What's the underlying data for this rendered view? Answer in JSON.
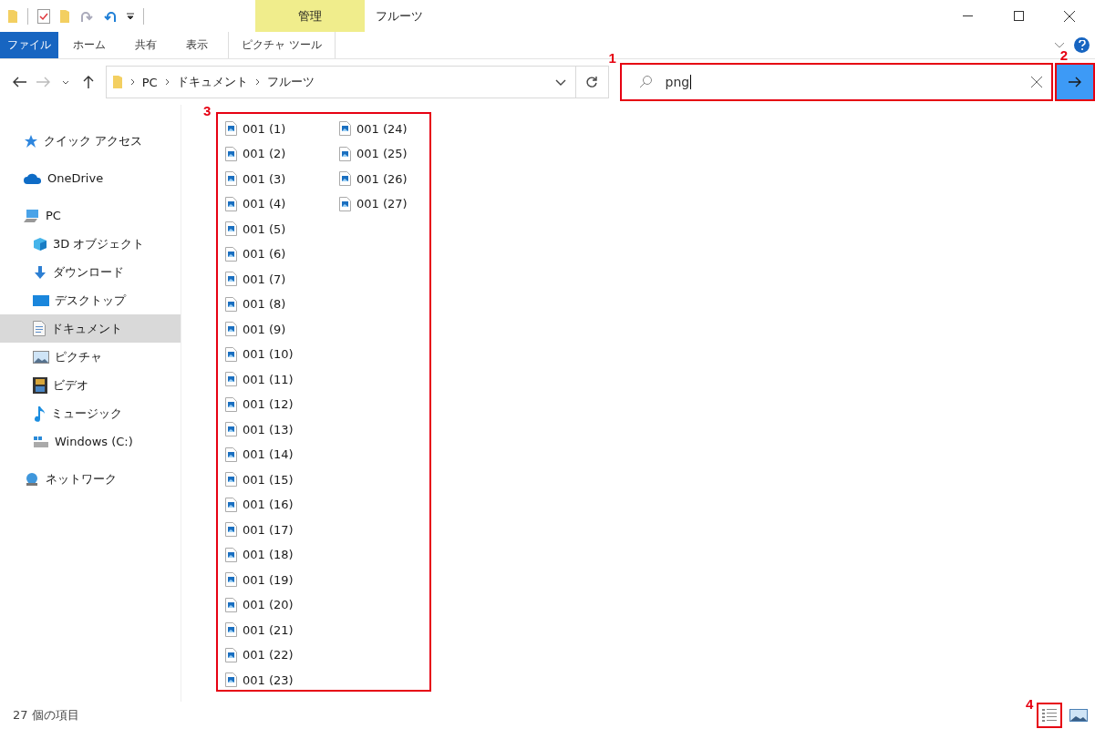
{
  "window": {
    "title": "フルーツ",
    "context_tab": "管理"
  },
  "ribbon_tabs": [
    {
      "label": "ファイル",
      "kind": "file"
    },
    {
      "label": "ホーム",
      "kind": "plain"
    },
    {
      "label": "共有",
      "kind": "plain"
    },
    {
      "label": "表示",
      "kind": "plain"
    },
    {
      "label": "ピクチャ ツール",
      "kind": "context"
    }
  ],
  "address": {
    "path": [
      "PC",
      "ドキュメント",
      "フルーツ"
    ]
  },
  "search": {
    "value": "png",
    "callout": "1"
  },
  "go_button": {
    "callout": "2"
  },
  "sidebar": {
    "items": [
      {
        "label": "クイック アクセス",
        "kind": "star",
        "selected": false
      },
      {
        "label": "OneDrive",
        "kind": "cloud",
        "selected": false
      },
      {
        "label": "PC",
        "kind": "pc",
        "selected": false,
        "children": [
          {
            "label": "3D オブジェクト",
            "kind": "cube",
            "selected": false
          },
          {
            "label": "ダウンロード",
            "kind": "download",
            "selected": false
          },
          {
            "label": "デスクトップ",
            "kind": "desktop",
            "selected": false
          },
          {
            "label": "ドキュメント",
            "kind": "document",
            "selected": true
          },
          {
            "label": "ピクチャ",
            "kind": "picture",
            "selected": false
          },
          {
            "label": "ビデオ",
            "kind": "video",
            "selected": false
          },
          {
            "label": "ミュージック",
            "kind": "music",
            "selected": false
          },
          {
            "label": "Windows (C:)",
            "kind": "drive",
            "selected": false
          }
        ]
      },
      {
        "label": "ネットワーク",
        "kind": "network",
        "selected": false
      }
    ]
  },
  "files": {
    "callout": "3",
    "items": [
      "001 (1)",
      "001 (2)",
      "001 (3)",
      "001 (4)",
      "001 (5)",
      "001 (6)",
      "001 (7)",
      "001 (8)",
      "001 (9)",
      "001 (10)",
      "001 (11)",
      "001 (12)",
      "001 (13)",
      "001 (14)",
      "001 (15)",
      "001 (16)",
      "001 (17)",
      "001 (18)",
      "001 (19)",
      "001 (20)",
      "001 (21)",
      "001 (22)",
      "001 (23)",
      "001 (24)",
      "001 (25)",
      "001 (26)",
      "001 (27)"
    ]
  },
  "status_bar": {
    "text": "27 個の項目",
    "view_callout": "4"
  }
}
